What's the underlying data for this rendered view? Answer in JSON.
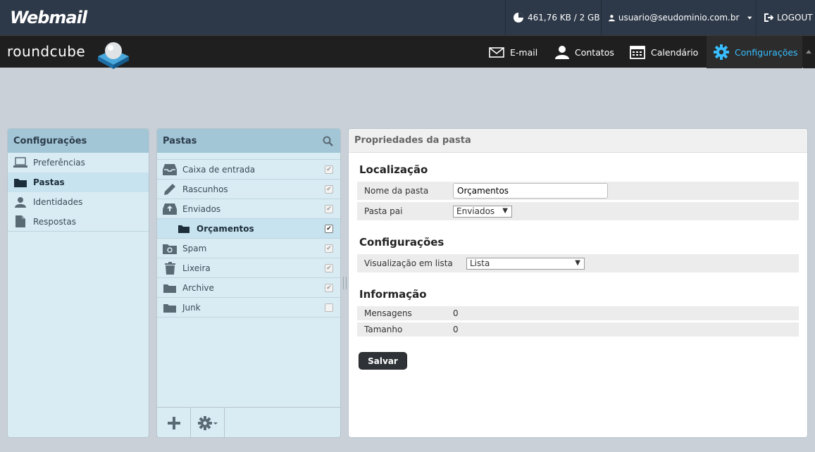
{
  "topbar": {
    "brand": "Webmail",
    "quota": "461,76 KB / 2 GB",
    "user": "usuario@seudominio.com.br",
    "logout": "LOGOUT"
  },
  "appbar": {
    "brand": "roundcube",
    "nav": {
      "email": "E-mail",
      "contatos": "Contatos",
      "calendario": "Calendário",
      "configuracoes": "Configurações"
    },
    "active_color": "#37beff"
  },
  "left": {
    "title": "Configurações",
    "items": [
      {
        "label": "Preferências",
        "icon": "laptop-icon"
      },
      {
        "label": "Pastas",
        "icon": "folder-icon"
      },
      {
        "label": "Identidades",
        "icon": "person-icon"
      },
      {
        "label": "Respostas",
        "icon": "document-icon"
      }
    ]
  },
  "mid": {
    "title": "Pastas",
    "folders": [
      {
        "label": "Caixa de entrada",
        "icon": "inbox-icon",
        "subscribed": true
      },
      {
        "label": "Rascunhos",
        "icon": "pencil-icon",
        "subscribed": true
      },
      {
        "label": "Enviados",
        "icon": "sent-icon",
        "subscribed": true
      },
      {
        "label": "Orçamentos",
        "icon": "folder-icon",
        "subscribed": true
      },
      {
        "label": "Spam",
        "icon": "spam-icon",
        "subscribed": true
      },
      {
        "label": "Lixeira",
        "icon": "trash-icon",
        "subscribed": true
      },
      {
        "label": "Archive",
        "icon": "folder-icon",
        "subscribed": true
      },
      {
        "label": "Junk",
        "icon": "folder-icon",
        "subscribed": false
      }
    ]
  },
  "right": {
    "title": "Propriedades da pasta",
    "section_location": "Localização",
    "name_label": "Nome da pasta",
    "name_value": "Orçamentos",
    "parent_label": "Pasta pai",
    "parent_value": "Enviados",
    "section_settings": "Configurações",
    "view_label": "Visualização em lista",
    "view_value": "Lista",
    "section_info": "Informação",
    "messages_label": "Mensagens",
    "messages_value": "0",
    "size_label": "Tamanho",
    "size_value": "0",
    "save": "Salvar"
  }
}
